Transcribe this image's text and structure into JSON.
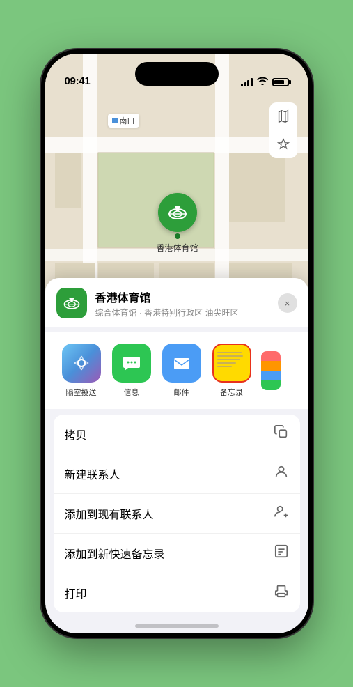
{
  "status_bar": {
    "time": "09:41",
    "location_arrow": "▶"
  },
  "map": {
    "label_text": "南口",
    "controls": [
      "🗺",
      "◎"
    ],
    "venue_pin_label": "香港体育馆"
  },
  "sheet": {
    "venue_name": "香港体育馆",
    "venue_desc": "综合体育馆 · 香港特别行政区 油尖旺区",
    "close_label": "×"
  },
  "share_items": [
    {
      "id": "airdrop",
      "label": "隔空投送"
    },
    {
      "id": "messages",
      "label": "信息"
    },
    {
      "id": "mail",
      "label": "邮件"
    },
    {
      "id": "notes",
      "label": "备忘录"
    }
  ],
  "action_items": [
    {
      "label": "拷贝",
      "icon": "⎘"
    },
    {
      "label": "新建联系人",
      "icon": "👤"
    },
    {
      "label": "添加到现有联系人",
      "icon": "👤"
    },
    {
      "label": "添加到新快速备忘录",
      "icon": "🖊"
    },
    {
      "label": "打印",
      "icon": "🖨"
    }
  ]
}
